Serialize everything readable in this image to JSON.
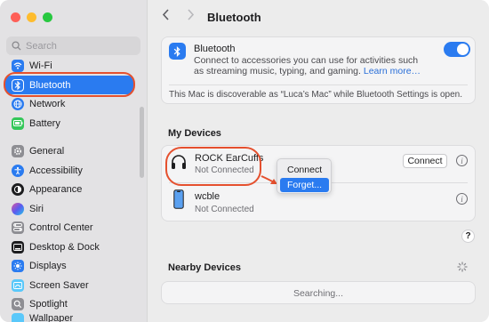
{
  "window": {
    "title": "Bluetooth"
  },
  "sidebar": {
    "search_placeholder": "Search",
    "items": [
      {
        "label": "Wi-Fi",
        "icon": "wifi-icon",
        "color": "#2a7bf0"
      },
      {
        "label": "Bluetooth",
        "icon": "bluetooth-icon",
        "color": "#2a7bf0",
        "selected": true
      },
      {
        "label": "Network",
        "icon": "globe-icon",
        "color": "#2a7bf0"
      },
      {
        "label": "Battery",
        "icon": "battery-icon",
        "color": "#34c759"
      },
      {
        "label": "General",
        "icon": "gear-icon",
        "color": "#8e8e93"
      },
      {
        "label": "Accessibility",
        "icon": "accessibility-icon",
        "color": "#2a7bf0"
      },
      {
        "label": "Appearance",
        "icon": "appearance-icon",
        "color": "#1d1d1f"
      },
      {
        "label": "Siri",
        "icon": "siri-icon",
        "color": "#9b59b6"
      },
      {
        "label": "Control Center",
        "icon": "control-center-icon",
        "color": "#8e8e93"
      },
      {
        "label": "Desktop & Dock",
        "icon": "dock-icon",
        "color": "#1d1d1f"
      },
      {
        "label": "Displays",
        "icon": "sun-icon",
        "color": "#2a7bf0"
      },
      {
        "label": "Screen Saver",
        "icon": "screen-saver-icon",
        "color": "#5ac8fa"
      },
      {
        "label": "Spotlight",
        "icon": "spotlight-icon",
        "color": "#8e8e93"
      },
      {
        "label": "Wallpaper",
        "icon": "wallpaper-icon",
        "color": "#5ac8fa"
      }
    ]
  },
  "main": {
    "title": "Bluetooth",
    "bluetooth_card": {
      "title": "Bluetooth",
      "description": "Connect to accessories you can use for activities such as streaming music, typing, and gaming.",
      "learn_more": "Learn more…",
      "toggle_on": true,
      "discoverable_note": "This Mac is discoverable as “Luca’s Mac” while Bluetooth Settings is open."
    },
    "my_devices": {
      "title": "My Devices",
      "devices": [
        {
          "name": "ROCK EarCuffs",
          "status": "Not Connected",
          "icon": "headphones-icon",
          "action": "Connect"
        },
        {
          "name": "wcble",
          "status": "Not Connected",
          "icon": "phone-icon"
        }
      ]
    },
    "context_menu": {
      "items": [
        "Connect",
        "Forget..."
      ],
      "highlighted": "Forget..."
    },
    "nearby_devices": {
      "title": "Nearby Devices",
      "status": "Searching..."
    },
    "help_label": "?"
  },
  "colors": {
    "accent": "#2a7bf0",
    "annotation": "#e5502e"
  }
}
